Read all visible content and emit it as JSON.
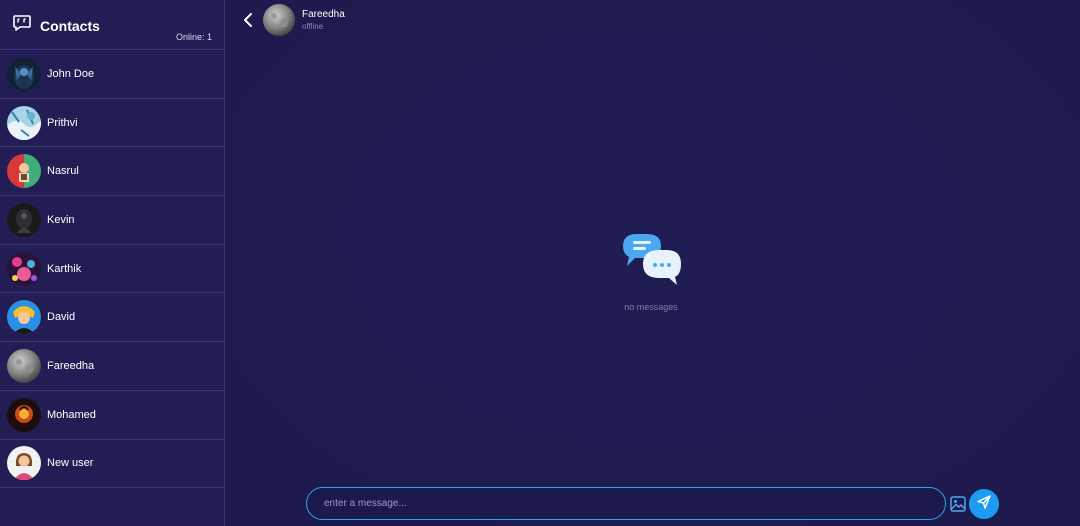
{
  "sidebar": {
    "title": "Contacts",
    "online_label": "Online: 1",
    "contacts": [
      {
        "name": "John Doe"
      },
      {
        "name": "Prithvi"
      },
      {
        "name": "Nasrul"
      },
      {
        "name": "Kevin"
      },
      {
        "name": "Karthik"
      },
      {
        "name": "David"
      },
      {
        "name": "Fareedha"
      },
      {
        "name": "Mohamed"
      },
      {
        "name": "New user"
      }
    ]
  },
  "chat": {
    "name": "Fareedha",
    "status": "offline",
    "empty_text": "no messages",
    "composer_placeholder": "enter a message..."
  },
  "icons": {
    "contacts": "chat-bubble-icon",
    "back": "chevron-left-icon",
    "empty": "chat-bubbles-icon",
    "image": "image-icon",
    "send": "send-icon"
  },
  "colors": {
    "background": "#1e1b4f",
    "sidebar": "#221e55",
    "accent": "#1d9bf0"
  }
}
